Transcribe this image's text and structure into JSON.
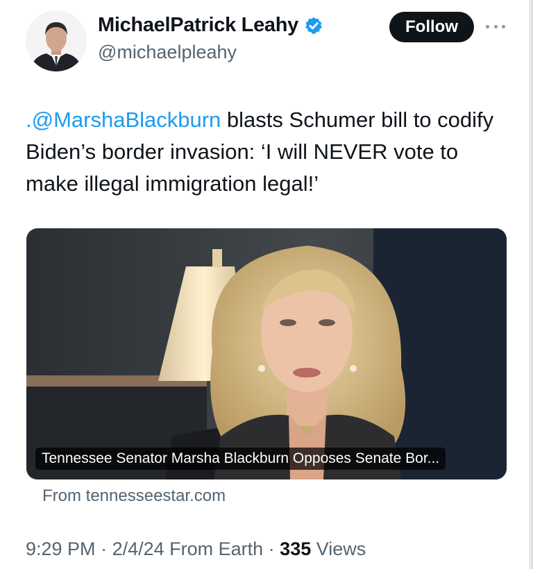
{
  "author": {
    "display_name": "MichaelPatrick Leahy",
    "handle": "@michaelpleahy",
    "verified_icon": "verified-badge-icon",
    "verified_color": "#1d9bf0"
  },
  "follow_label": "Follow",
  "more_icon": "more-options-icon",
  "tweet": {
    "mention": ".@MarshaBlackburn",
    "text": " blasts Schumer bill to codify Biden’s border invasion: ‘I will NEVER vote to make illegal immigration legal!’"
  },
  "card": {
    "caption": "Tennessee Senator Marsha Blackburn Opposes Senate Bor...",
    "source": "From tennesseestar.com"
  },
  "meta": {
    "time": "9:29 PM",
    "sep1": " · ",
    "date": "2/4/24",
    "via": " From Earth",
    "sep2": " · ",
    "views": "335",
    "views_label": " Views"
  },
  "colors": {
    "link": "#1d9bf0",
    "text": "#0f1419",
    "secondary": "#536471"
  }
}
